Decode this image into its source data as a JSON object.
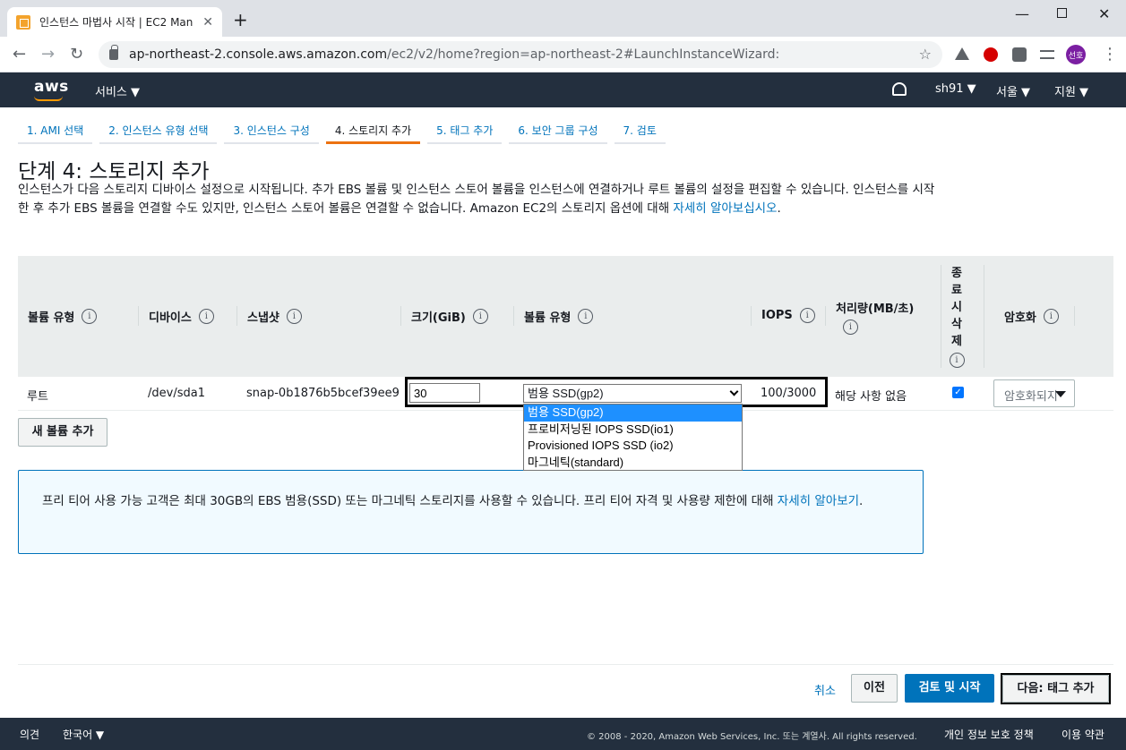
{
  "browser": {
    "tab_title": "인스턴스 마법사 시작 | EC2 Man",
    "url_host": "ap-northeast-2.console.aws.amazon.com",
    "url_path": "/ec2/v2/home?region=ap-northeast-2#LaunchInstanceWizard:",
    "avatar_label": "선호"
  },
  "aws_nav": {
    "logo": "aws",
    "services": "서비스 ▼",
    "user": "sh91 ▼",
    "region": "서울 ▼",
    "support": "지원 ▼"
  },
  "wizard": {
    "steps": [
      "1. AMI 선택",
      "2. 인스턴스 유형 선택",
      "3. 인스턴스 구성",
      "4. 스토리지 추가",
      "5. 태그 추가",
      "6. 보안 그룹 구성",
      "7. 검토"
    ],
    "active_step": 3,
    "title": "단계 4: 스토리지 추가",
    "description": "인스턴스가 다음 스토리지 디바이스 설정으로 시작됩니다. 추가 EBS 볼륨 및 인스턴스 스토어 볼륨을 인스턴스에 연결하거나 루트 볼륨의 설정을 편집할 수 있습니다. 인스턴스를 시작한 후 추가 EBS 볼륨을 연결할 수도 있지만, 인스턴스 스토어 볼륨은 연결할 수 없습니다. Amazon EC2의 스토리지 옵션에 대해 ",
    "description_link": "자세히 알아보십시오",
    "description_end": "."
  },
  "table": {
    "headers": {
      "volume_type": "볼륨 유형",
      "device": "디바이스",
      "snapshot": "스냅샷",
      "size": "크기(GiB)",
      "ebs_type": "볼륨 유형",
      "iops": "IOPS",
      "throughput": "처리량(MB/초)",
      "delete": "종료 시 삭제",
      "encryption": "암호화"
    },
    "info_glyph": "i",
    "row": {
      "volume_type": "루트",
      "device": "/dev/sda1",
      "snapshot": "snap-0b1876b5bcef39ee9",
      "size": "30",
      "ebs_type": "범용 SSD(gp2)",
      "iops": "100/3000",
      "throughput": "해당 사항 없음",
      "delete_checked": true,
      "encryption": "암호화되지"
    },
    "dropdown_options": [
      "범용 SSD(gp2)",
      "프로비저닝된 IOPS SSD(io1)",
      "Provisioned IOPS SSD (io2)",
      "마그네틱(standard)"
    ],
    "selected_option": 0
  },
  "add_volume_button": "새 볼륨 추가",
  "info_box": {
    "text": "프리 티어 사용 가능 고객은 최대 30GB의 EBS 범용(SSD) 또는 마그네틱 스토리지를 사용할 수 있습니다. 프리 티어 자격 및 사용량 제한에 대해 ",
    "link": "자세히 알아보기",
    "end": "."
  },
  "actions": {
    "cancel": "취소",
    "previous": "이전",
    "review_launch": "검토 및 시작",
    "next": "다음: 태그 추가"
  },
  "footer": {
    "feedback": "의견",
    "language": "한국어 ▼",
    "copyright": "© 2008 - 2020, Amazon Web Services, Inc. 또는 계열사. All rights reserved.",
    "privacy": "개인 정보 보호 정책",
    "terms": "이용 약관"
  },
  "colors": {
    "aws_nav": "#232f3e",
    "link": "#0073bb",
    "accent": "#ec7211",
    "primary_button": "#0073bb"
  }
}
